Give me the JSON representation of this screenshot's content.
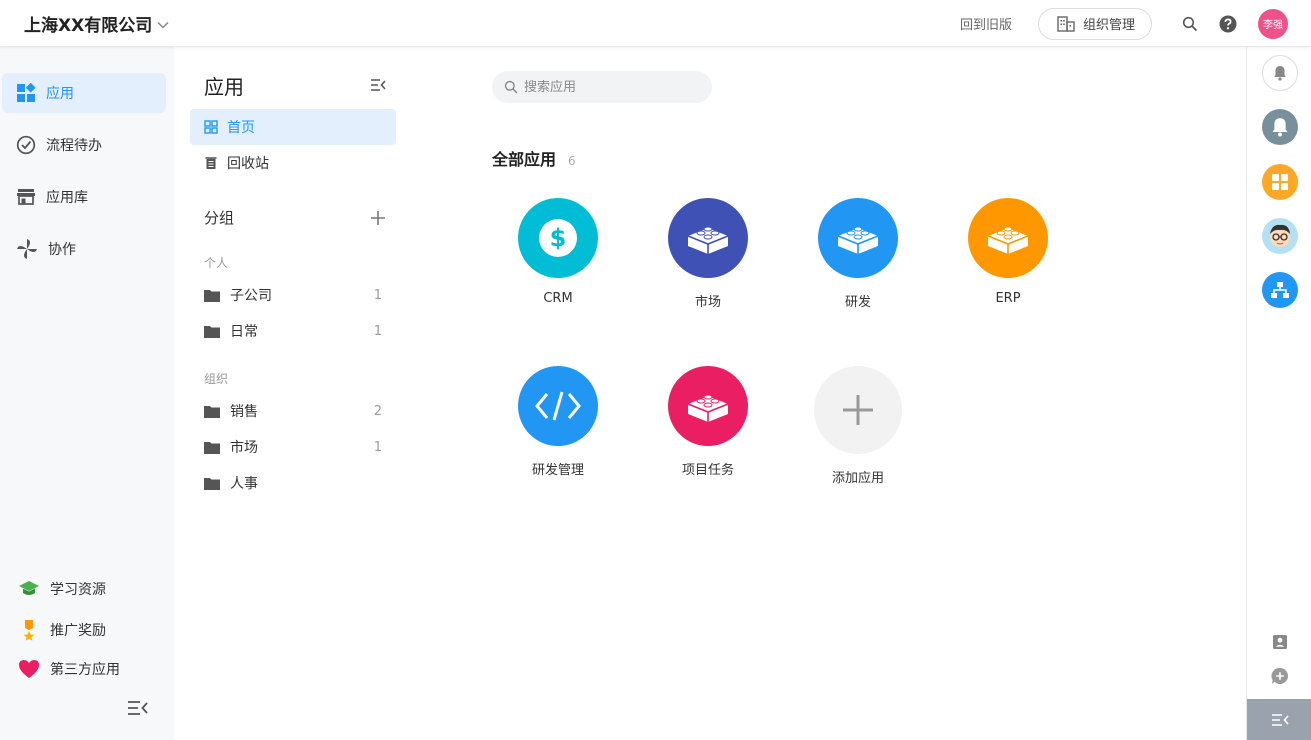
{
  "topbar": {
    "company": "上海XX有限公司",
    "old_version": "回到旧版",
    "org_manage": "组织管理",
    "avatar_text": "李强"
  },
  "leftnav": {
    "items": [
      {
        "label": "应用"
      },
      {
        "label": "流程待办"
      },
      {
        "label": "应用库"
      },
      {
        "label": "协作"
      }
    ],
    "bottom": [
      {
        "label": "学习资源"
      },
      {
        "label": "推广奖励"
      },
      {
        "label": "第三方应用"
      }
    ]
  },
  "subpanel": {
    "title": "应用",
    "home": "首页",
    "trash": "回收站",
    "group_title": "分组",
    "personal_label": "个人",
    "personal": [
      {
        "name": "子公司",
        "count": "1"
      },
      {
        "name": "日常",
        "count": "1"
      }
    ],
    "org_label": "组织",
    "org": [
      {
        "name": "销售",
        "count": "2"
      },
      {
        "name": "市场",
        "count": "1"
      },
      {
        "name": "人事",
        "count": ""
      }
    ]
  },
  "main": {
    "search_placeholder": "搜索应用",
    "all_apps": "全部应用",
    "app_count": "6",
    "apps": [
      {
        "label": "CRM",
        "color": "#00bcd4"
      },
      {
        "label": "市场",
        "color": "#3f51b5"
      },
      {
        "label": "研发",
        "color": "#2196f3"
      },
      {
        "label": "ERP",
        "color": "#ff9800"
      },
      {
        "label": "研发管理",
        "color": "#2196f3"
      },
      {
        "label": "项目任务",
        "color": "#e91e63"
      }
    ],
    "add_app": "添加应用"
  },
  "colors": {
    "accent": "#2196f3",
    "nav_active_bg": "#e3effc"
  }
}
